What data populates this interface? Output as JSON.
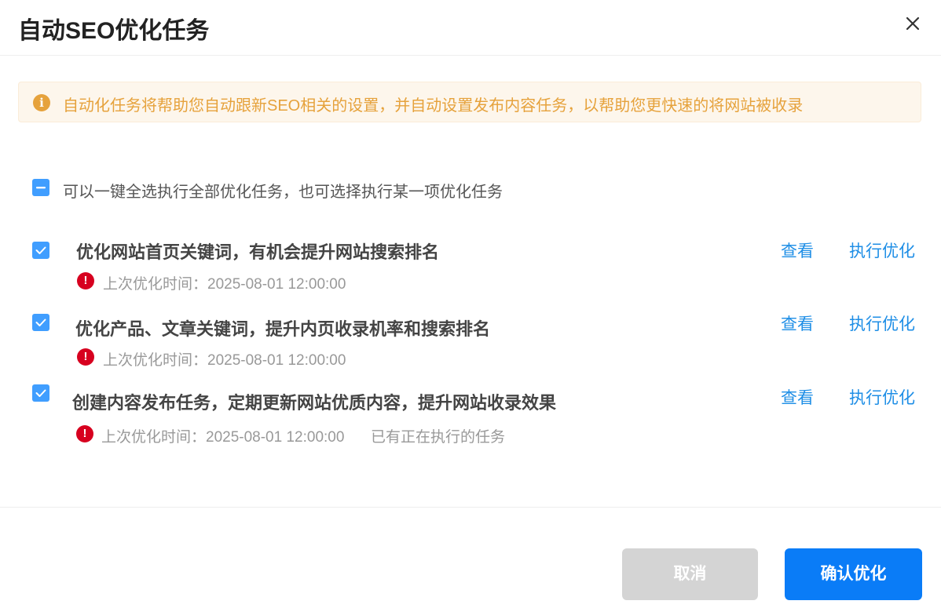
{
  "dialog": {
    "title": "自动SEO优化任务"
  },
  "notice": {
    "icon": "info-icon",
    "icon_glyph": "i",
    "text": "自动化任务将帮助您自动跟新SEO相关的设置，并自动设置发布内容任务，以帮助您更快速的将网站被收录"
  },
  "select_all": {
    "state": "indeterminate",
    "label": "可以一键全选执行全部优化任务，也可选择执行某一项优化任务"
  },
  "tasks": [
    {
      "checked": true,
      "title": "优化网站首页关键词，有机会提升网站搜索排名",
      "last_time": "上次优化时间：2025-08-01 12:00:00",
      "extra": "",
      "view_label": "查看",
      "run_label": "执行优化"
    },
    {
      "checked": true,
      "title": "优化产品、文章关键词，提升内页收录机率和搜索排名",
      "last_time": "上次优化时间：2025-08-01 12:00:00",
      "extra": "",
      "view_label": "查看",
      "run_label": "执行优化"
    },
    {
      "checked": true,
      "title": "创建内容发布任务，定期更新网站优质内容，提升网站收录效果",
      "last_time": "上次优化时间：2025-08-01 12:00:00",
      "extra": "已有正在执行的任务",
      "view_label": "查看",
      "run_label": "执行优化"
    }
  ],
  "warn_glyph": "!",
  "footer": {
    "cancel_label": "取消",
    "confirm_label": "确认优化"
  },
  "colors": {
    "primary": "#409eff",
    "link": "#1e8ee6",
    "warning": "#e6a23c",
    "danger": "#d7001f",
    "confirm_button": "#0a7cf7",
    "cancel_button": "#d4d4d4"
  }
}
